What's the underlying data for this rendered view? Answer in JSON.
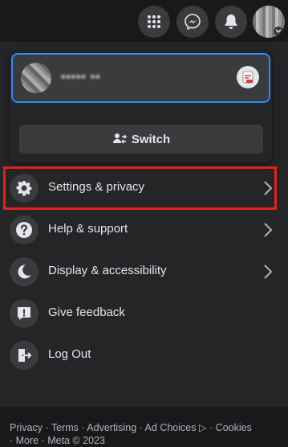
{
  "topbar": {
    "icons": [
      "menu-grid-icon",
      "messenger-icon",
      "notifications-bell-icon"
    ]
  },
  "profile": {
    "name": "▪▪▪▪▪ ▪▪",
    "switch_label": "Switch"
  },
  "menu_items": [
    {
      "label": "Settings & privacy",
      "icon": "gear-icon",
      "has_chevron": true
    },
    {
      "label": "Help & support",
      "icon": "question-icon",
      "has_chevron": true
    },
    {
      "label": "Display & accessibility",
      "icon": "moon-icon",
      "has_chevron": true
    },
    {
      "label": "Give feedback",
      "icon": "feedback-icon",
      "has_chevron": false
    },
    {
      "label": "Log Out",
      "icon": "logout-icon",
      "has_chevron": false
    }
  ],
  "footer": {
    "line1": "Privacy · Terms · Advertising · Ad Choices ▷ · Cookies",
    "line2": "· More · Meta © 2023"
  },
  "colors": {
    "page_bg": "#18191a",
    "menu_bg": "#242526",
    "surface": "#3a3b3c",
    "text": "#e4e6eb",
    "muted": "#b0b3b8",
    "focus_blue": "#2d88ff",
    "highlight_red": "#e3201b"
  }
}
